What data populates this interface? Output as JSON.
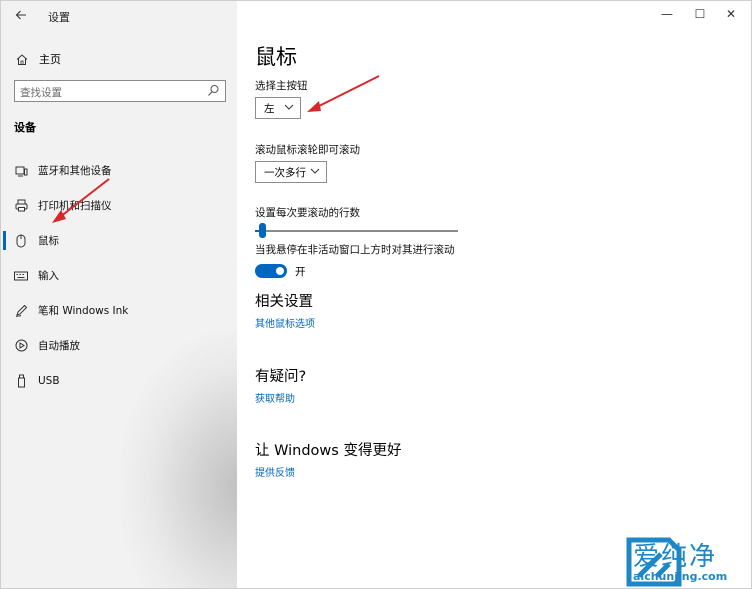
{
  "window": {
    "title": "设置",
    "back_icon": "back-arrow-icon",
    "controls": {
      "minimize": "—",
      "maximize": "☐",
      "close": "✕"
    }
  },
  "sidebar": {
    "home_label": "主页",
    "search_placeholder": "查找设置",
    "section_title": "设备",
    "items": [
      {
        "label": "蓝牙和其他设备",
        "icon": "bluetooth-devices-icon",
        "active": false
      },
      {
        "label": "打印机和扫描仪",
        "icon": "printer-icon",
        "active": false
      },
      {
        "label": "鼠标",
        "icon": "mouse-icon",
        "active": true
      },
      {
        "label": "输入",
        "icon": "keyboard-icon",
        "active": false
      },
      {
        "label": "笔和 Windows Ink",
        "icon": "pen-icon",
        "active": false
      },
      {
        "label": "自动播放",
        "icon": "autoplay-icon",
        "active": false
      },
      {
        "label": "USB",
        "icon": "usb-icon",
        "active": false
      }
    ]
  },
  "main": {
    "title": "鼠标",
    "primary_button_label": "选择主按钮",
    "primary_button_value": "左",
    "scroll_label": "滚动鼠标滚轮即可滚动",
    "scroll_value": "一次多行",
    "lines_label": "设置每次要滚动的行数",
    "lines_level": 0.02,
    "inactive_scroll_label": "当我悬停在非活动窗口上方时对其进行滚动",
    "inactive_scroll_state": "开",
    "related_title": "相关设置",
    "related_link": "其他鼠标选项",
    "question_title": "有疑问?",
    "question_link": "获取帮助",
    "improve_title": "让 Windows 变得更好",
    "improve_link": "提供反馈"
  },
  "watermark": {
    "text": "爱纯净",
    "url": "aichunjing.com"
  },
  "colors": {
    "accent": "#0067c0",
    "annotation_arrow": "#d62828",
    "watermark": "#1e88c6"
  }
}
